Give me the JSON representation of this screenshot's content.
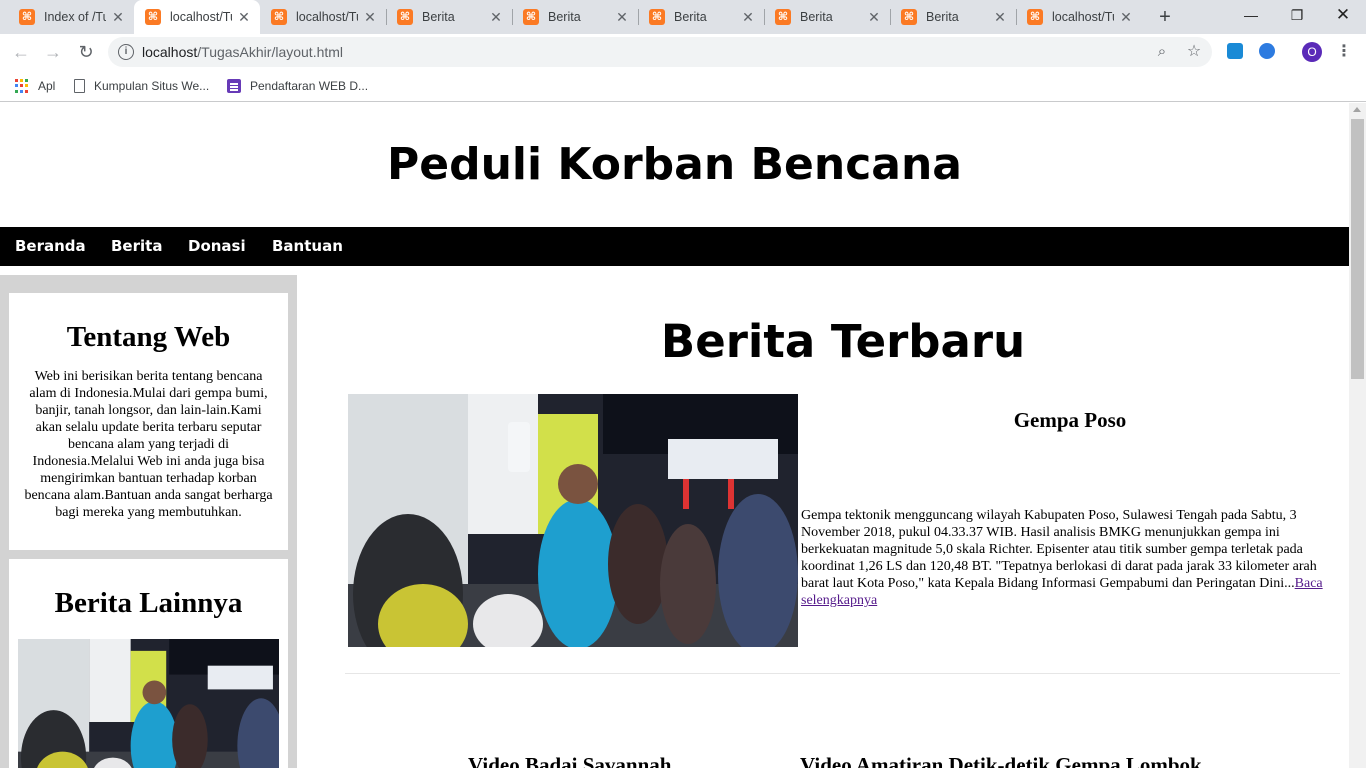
{
  "browser": {
    "tabs": [
      {
        "title": "Index of /Tu",
        "active": false
      },
      {
        "title": "localhost/Tu",
        "active": true
      },
      {
        "title": "localhost/Tu",
        "active": false
      },
      {
        "title": "Berita",
        "active": false
      },
      {
        "title": "Berita",
        "active": false
      },
      {
        "title": "Berita",
        "active": false
      },
      {
        "title": "Berita",
        "active": false
      },
      {
        "title": "Berita",
        "active": false
      },
      {
        "title": "localhost/Tu",
        "active": false
      }
    ],
    "url_host": "localhost",
    "url_path": "/TugasAkhir/layout.html",
    "profile_initial": "O",
    "bookmarks": [
      {
        "label": "Apl",
        "icon": "apps-grid-icon"
      },
      {
        "label": "Kumpulan Situs We...",
        "icon": "page-icon"
      },
      {
        "label": "Pendaftaran WEB D...",
        "icon": "form-icon"
      }
    ]
  },
  "site": {
    "title": "Peduli Korban Bencana",
    "nav": [
      "Beranda",
      "Berita",
      "Donasi",
      "Bantuan"
    ]
  },
  "sidebar": {
    "about_title": "Tentang Web",
    "about_text": "Web ini berisikan berita tentang bencana alam di Indonesia.Mulai dari gempa bumi, banjir, tanah longsor, dan lain-lain.Kami akan selalu update berita terbaru seputar bencana alam yang terjadi di Indonesia.Melalui Web ini anda juga bisa mengirimkan bantuan terhadap korban bencana alam.Bantuan anda sangat berharga bagi mereka yang membutuhkan.",
    "other_title": "Berita Lainnya"
  },
  "main": {
    "section_title": "Berita Terbaru",
    "article": {
      "title": "Gempa Poso",
      "body": "Gempa tektonik mengguncang wilayah Kabupaten Poso, Sulawesi Tengah pada Sabtu, 3 November 2018, pukul 04.33.37 WIB. Hasil analisis BMKG menunjukkan gempa ini berkekuatan magnitude 5,0 skala Richter. Episenter atau titik sumber gempa terletak pada koordinat 1,26 LS dan 120,48 BT. \"Tepatnya berlokasi di darat pada jarak 33 kilometer arah barat laut Kota Poso,\" kata Kepala Bidang Informasi Gempabumi dan Peringatan Dini...",
      "read_more": "Baca selengkapnya"
    },
    "videos": [
      {
        "title": "Video Badai Savannah"
      },
      {
        "title": "Video Amatiran Detik-detik Gempa Lombok"
      }
    ]
  },
  "colors": {
    "navbar_bg": "#000000",
    "sidebar_bg": "#d3d3d3",
    "link_visited": "#551a8b",
    "xampp_orange": "#fb7a24"
  }
}
